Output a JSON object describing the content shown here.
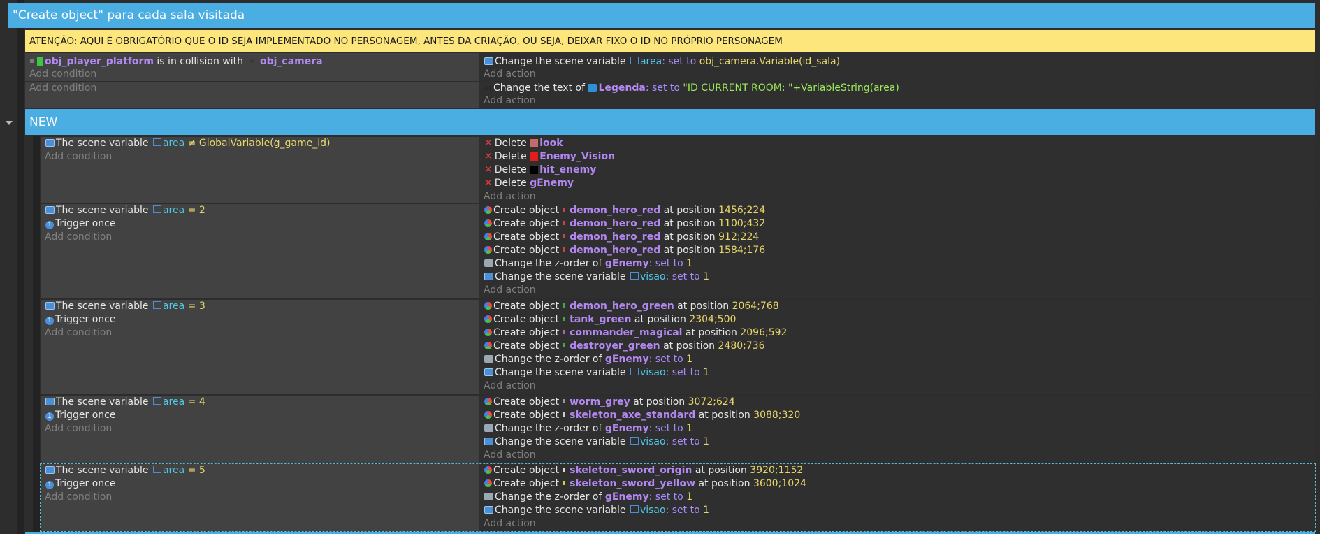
{
  "group_title": "\"Create object\" para cada sala visitada",
  "warning_note": "ATENÇÃO: AQUI É OBRIGATÓRIO QUE O ID SEJA IMPLEMENTADO NO PERSONAGEM, ANTES DA CRIAÇÃO, OU SEJA, DEIXAR FIXO O ID NO PRÓPRIO PERSONAGEM",
  "add_condition": "Add condition",
  "add_action": "Add action",
  "ev1": {
    "cond_obj": "obj_player_platform",
    "cond_text": "is in collision with",
    "cond_obj2": "obj_camera",
    "a1_text": "Change the scene variable",
    "a1_var": "area",
    "a1_set": ": set to",
    "a1_val": "obj_camera.Variable(id_sala)"
  },
  "ev2": {
    "a1_text": "Change the text of",
    "a1_obj": "Legenda",
    "a1_set": ": set to",
    "a1_val": "\"ID CURRENT ROOM: \"+VariableString(area)"
  },
  "new_group": "NEW",
  "ev3": {
    "c1_text": "The scene variable",
    "c1_var": "area",
    "c1_op": "≠",
    "c1_val": "GlobalVariable(g_game_id)",
    "actions": [
      {
        "label": "Delete",
        "obj": "look",
        "color": "#c46a6a"
      },
      {
        "label": "Delete",
        "obj": "Enemy_Vision",
        "color": "#e21b1b"
      },
      {
        "label": "Delete",
        "obj": "hit_enemy",
        "color": "#000000"
      },
      {
        "label": "Delete",
        "obj": "gEnemy",
        "color": ""
      }
    ]
  },
  "scene_var_label": "The scene variable",
  "var_area": "area",
  "eq": "=",
  "trigger_once": "Trigger once",
  "create_label": "Create object",
  "at_position": "at position",
  "zorder_label": "Change the z-order of",
  "gEnemy": "gEnemy",
  "set_to": ": set to",
  "one": "1",
  "scene_change_label": "Change the scene variable",
  "var_visao": "visao",
  "ev4": {
    "value": "2",
    "creates": [
      {
        "obj": "demon_hero_red",
        "pos": "1456;224"
      },
      {
        "obj": "demon_hero_red",
        "pos": "1100;432"
      },
      {
        "obj": "demon_hero_red",
        "pos": "912;224"
      },
      {
        "obj": "demon_hero_red",
        "pos": "1584;176"
      }
    ]
  },
  "ev5": {
    "value": "3",
    "creates": [
      {
        "obj": "demon_hero_green",
        "pos": "2064;768"
      },
      {
        "obj": "tank_green",
        "pos": "2304;500"
      },
      {
        "obj": "commander_magical",
        "pos": "2096;592"
      },
      {
        "obj": "destroyer_green",
        "pos": "2480;736"
      }
    ]
  },
  "ev6": {
    "value": "4",
    "creates": [
      {
        "obj": "worm_grey",
        "pos": "3072;624"
      },
      {
        "obj": "skeleton_axe_standard",
        "pos": "3088;320"
      }
    ]
  },
  "ev7": {
    "value": "5",
    "creates": [
      {
        "obj": "skeleton_sword_origin",
        "pos": "3920;1152"
      },
      {
        "obj": "skeleton_sword_yellow",
        "pos": "3600;1024"
      }
    ]
  }
}
